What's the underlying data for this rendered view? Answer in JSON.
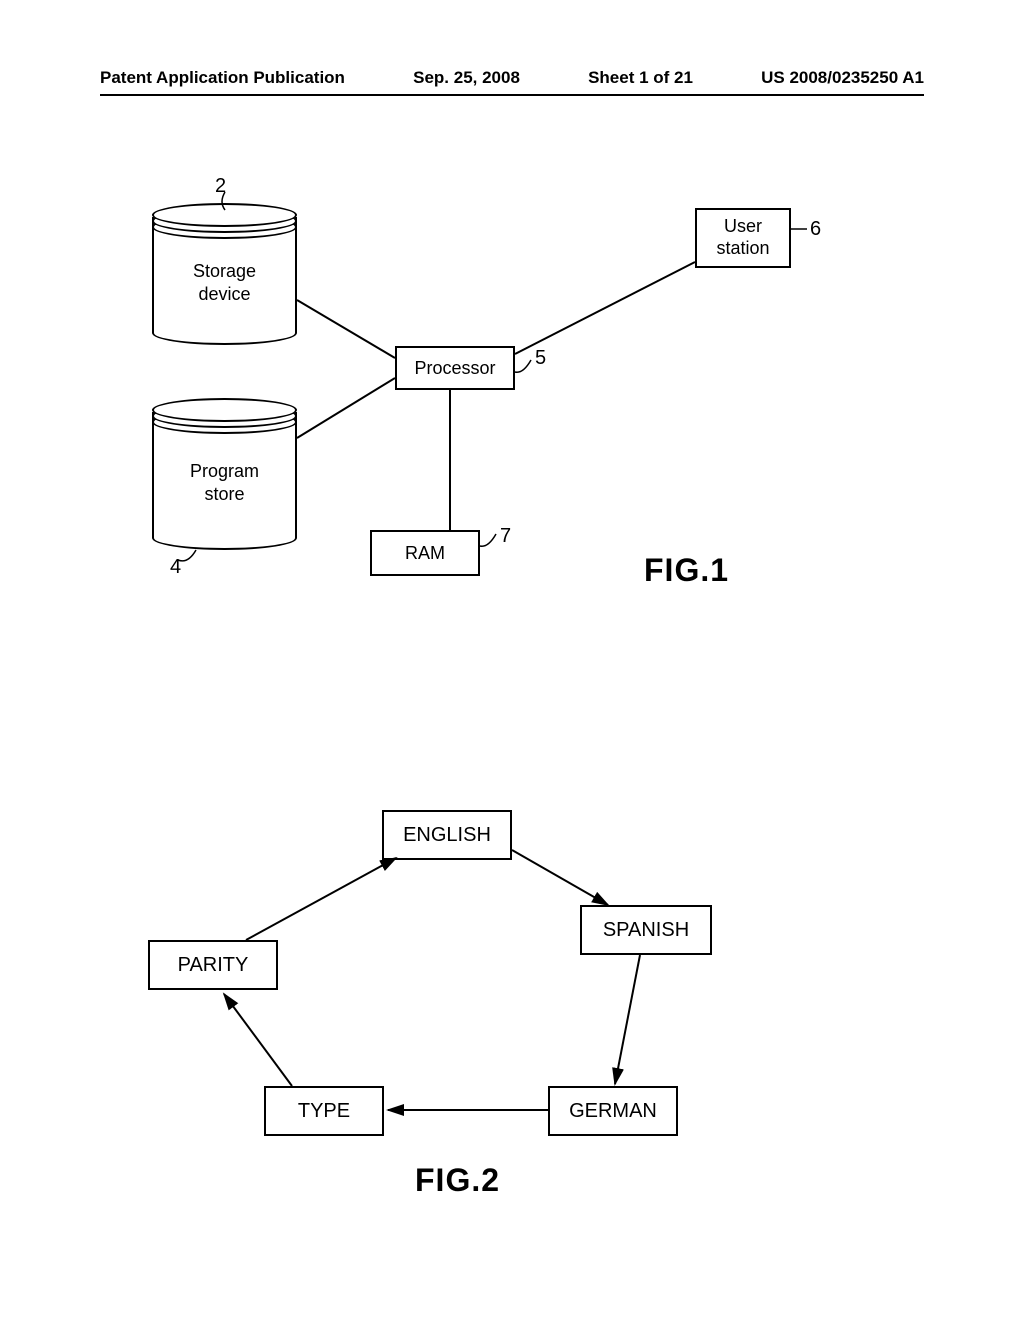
{
  "header": {
    "publication_type": "Patent Application Publication",
    "date": "Sep. 25, 2008",
    "sheet": "Sheet 1 of 21",
    "publication_number": "US 2008/0235250 A1"
  },
  "fig1": {
    "storage_device": "Storage\ndevice",
    "program_store": "Program\nstore",
    "processor": "Processor",
    "ram": "RAM",
    "user_station": "User\nstation",
    "ref_storage": "2",
    "ref_program": "4",
    "ref_processor": "5",
    "ref_user": "6",
    "ref_ram": "7",
    "label": "FIG.1"
  },
  "fig2": {
    "english": "ENGLISH",
    "spanish": "SPANISH",
    "german": "GERMAN",
    "type": "TYPE",
    "parity": "PARITY",
    "label": "FIG.2"
  }
}
